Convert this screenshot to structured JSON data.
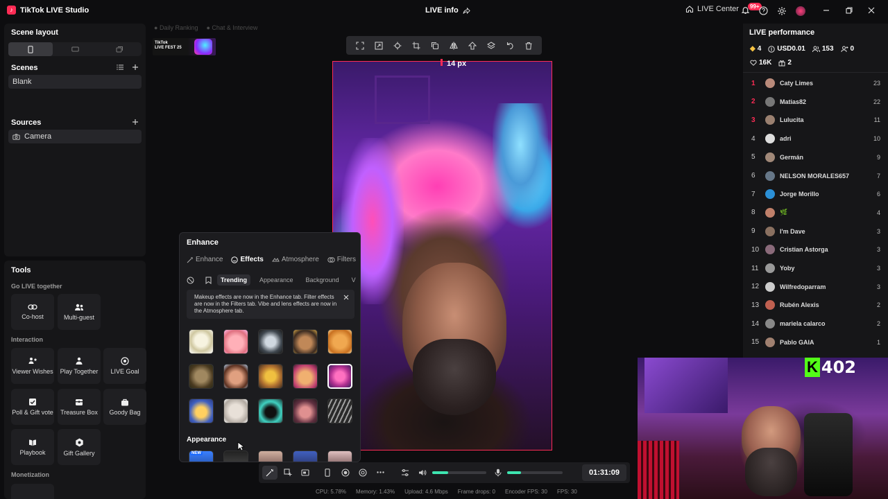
{
  "app": {
    "title": "TikTok LIVE Studio",
    "logo_letter": "♪"
  },
  "header": {
    "live_info": "LIVE info",
    "live_center": "LIVE Center",
    "notif_badge": "99+"
  },
  "left": {
    "scene_layout": "Scene layout",
    "scenes": {
      "title": "Scenes",
      "items": [
        "Blank"
      ]
    },
    "sources": {
      "title": "Sources",
      "items": [
        "Camera"
      ]
    },
    "tools": {
      "title": "Tools",
      "go_live_together": "Go LIVE together",
      "cohost": "Co-host",
      "multiguest": "Multi-guest",
      "interaction": "Interaction",
      "viewer_wishes": "Viewer Wishes",
      "play_together": "Play Together",
      "live_goal": "LIVE Goal",
      "poll": "Poll & Gift vote",
      "treasure": "Treasure Box",
      "goody": "Goody Bag",
      "playbook": "Playbook",
      "gift_gallery": "Gift Gallery",
      "monetization": "Monetization"
    }
  },
  "overlay": {
    "daily_ranking": "Daily Ranking",
    "chat_interview": "Chat & Interview",
    "fest_line1": "TikTok",
    "fest_line2": "LIVE FEST 25"
  },
  "canvas": {
    "px_label": "14 px"
  },
  "enhance": {
    "title": "Enhance",
    "tabs": [
      "Enhance",
      "Effects",
      "Atmosphere",
      "Filters"
    ],
    "pills": [
      "Trending",
      "Appearance",
      "Background",
      "V"
    ],
    "notice": "Makeup effects are now in the Enhance tab. Filter effects are now in the Filters tab. Vibe and lens effects are now in the Atmosphere tab.",
    "section_appearance": "Appearance",
    "new_badge": "NEW"
  },
  "bottom": {
    "timer": "01:31:09",
    "volume": 0.3,
    "mic": 0.25
  },
  "status": {
    "cpu": "CPU:  5.78%",
    "memory": "Memory:  1.43%",
    "upload": "Upload:  4.6 Mbps",
    "drops": "Frame drops:  0",
    "encoder": "Encoder FPS:  30",
    "fps": "FPS:  30"
  },
  "performance": {
    "title": "LIVE performance",
    "diamonds": "4",
    "usd": "USD0.01",
    "viewers": "153",
    "new_followers": "0",
    "likes": "16K",
    "gifts": "2"
  },
  "ranking": [
    {
      "rank": "1",
      "name": "Caty Limes",
      "score": "23",
      "color": "#b98a7a"
    },
    {
      "rank": "2",
      "name": "Matias82",
      "score": "22",
      "color": "#777"
    },
    {
      "rank": "3",
      "name": "Lulucita",
      "score": "11",
      "color": "#9a8070"
    },
    {
      "rank": "4",
      "name": "adri",
      "score": "10",
      "color": "#ddd"
    },
    {
      "rank": "5",
      "name": "Germán",
      "score": "9",
      "color": "#a08878"
    },
    {
      "rank": "6",
      "name": "NELSON MORALES657",
      "score": "7",
      "color": "#667788"
    },
    {
      "rank": "7",
      "name": "Jorge Morillo",
      "score": "6",
      "color": "#2b8fd6"
    },
    {
      "rank": "8",
      "name": "🌿",
      "score": "4",
      "color": "#c0806a"
    },
    {
      "rank": "9",
      "name": "I'm Dave",
      "score": "3",
      "color": "#8a7060"
    },
    {
      "rank": "10",
      "name": "Cristian Astorga",
      "score": "3",
      "color": "#8a6a7a"
    },
    {
      "rank": "11",
      "name": "Yoby",
      "score": "3",
      "color": "#999"
    },
    {
      "rank": "12",
      "name": "Wilfredoparram",
      "score": "3",
      "color": "#ccc"
    },
    {
      "rank": "13",
      "name": "Rubén Alexis",
      "score": "2",
      "color": "#c06050"
    },
    {
      "rank": "14",
      "name": "mariela calarco",
      "score": "2",
      "color": "#888"
    },
    {
      "rank": "15",
      "name": "Pablo GAIA",
      "score": "1",
      "color": "#a08070"
    }
  ],
  "webcam": {
    "badge_letter": "K",
    "badge_number": "402"
  }
}
